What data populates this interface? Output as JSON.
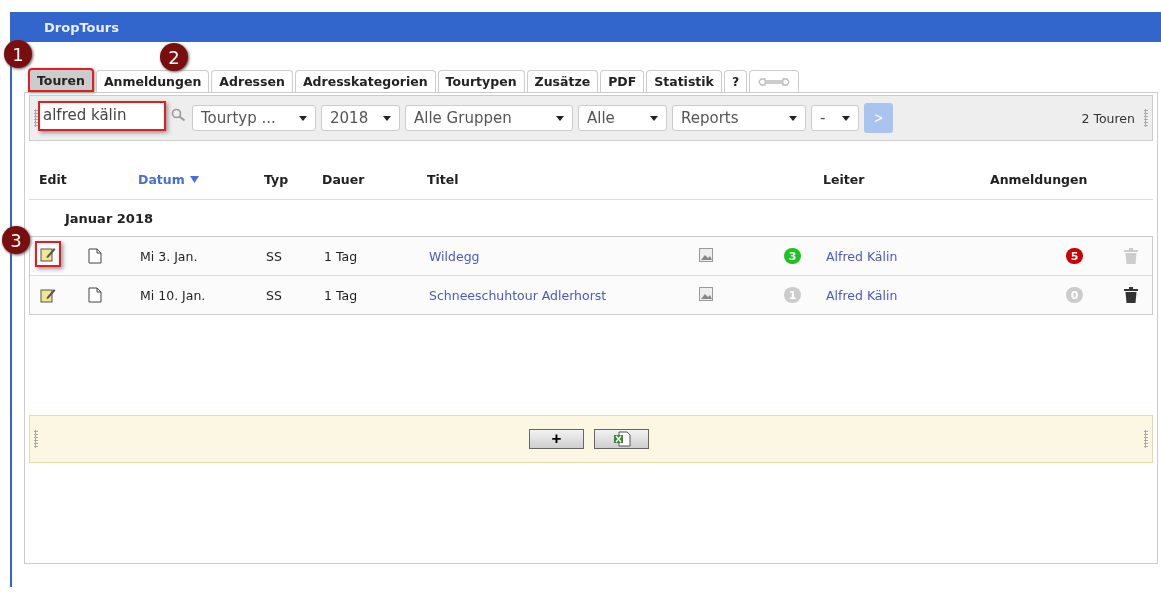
{
  "window": {
    "title": "DropTours"
  },
  "callouts": [
    "1",
    "2",
    "3"
  ],
  "tabs": [
    {
      "kind": "text",
      "label": "Touren",
      "selected": true
    },
    {
      "kind": "text",
      "label": "Anmeldungen",
      "selected": false
    },
    {
      "kind": "text",
      "label": "Adressen",
      "selected": false
    },
    {
      "kind": "text",
      "label": "Adresskategorien",
      "selected": false
    },
    {
      "kind": "text",
      "label": "Tourtypen",
      "selected": false
    },
    {
      "kind": "text",
      "label": "Zusätze",
      "selected": false
    },
    {
      "kind": "text",
      "label": "PDF",
      "selected": false
    },
    {
      "kind": "text",
      "label": "Statistik",
      "selected": false
    },
    {
      "kind": "text",
      "label": "?",
      "selected": false
    },
    {
      "kind": "icon",
      "selected": false
    }
  ],
  "toolbar": {
    "search": {
      "value": "alfred kälin"
    },
    "dropdowns": [
      "Tourtyp ...",
      "2018",
      "Alle Gruppen",
      "Alle",
      "Reports",
      "-"
    ],
    "go_button": ">",
    "count": "2 Touren"
  },
  "table": {
    "columns": [
      {
        "label": "Edit",
        "sorted": false
      },
      {
        "label": "Datum",
        "sorted": true
      },
      {
        "label": "Typ",
        "sorted": false
      },
      {
        "label": "Dauer",
        "sorted": false
      },
      {
        "label": "Titel",
        "sorted": false
      },
      {
        "label": "Leiter",
        "sorted": false
      },
      {
        "label": "Anmeldungen",
        "sorted": false
      }
    ],
    "group": "Januar 2018",
    "rows": [
      {
        "date": "Mi 3. Jan.",
        "type": "SS",
        "duration": "1 Tag",
        "title": "Wildegg",
        "badge": {
          "count": "3",
          "color": "#1fc31f"
        },
        "leader": "Alfred Kälin",
        "registrations": {
          "count": "5",
          "color": "#cc0000"
        },
        "deletable": false
      },
      {
        "date": "Mi 10. Jan.",
        "type": "SS",
        "duration": "1 Tag",
        "title": "Schneeschuhtour Adlerhorst",
        "badge": {
          "count": "1",
          "color": "#cccccc"
        },
        "leader": "Alfred Kälin",
        "registrations": {
          "count": "0",
          "color": "#cccccc"
        },
        "deletable": true
      }
    ]
  },
  "footer": {
    "add_button": "+"
  }
}
